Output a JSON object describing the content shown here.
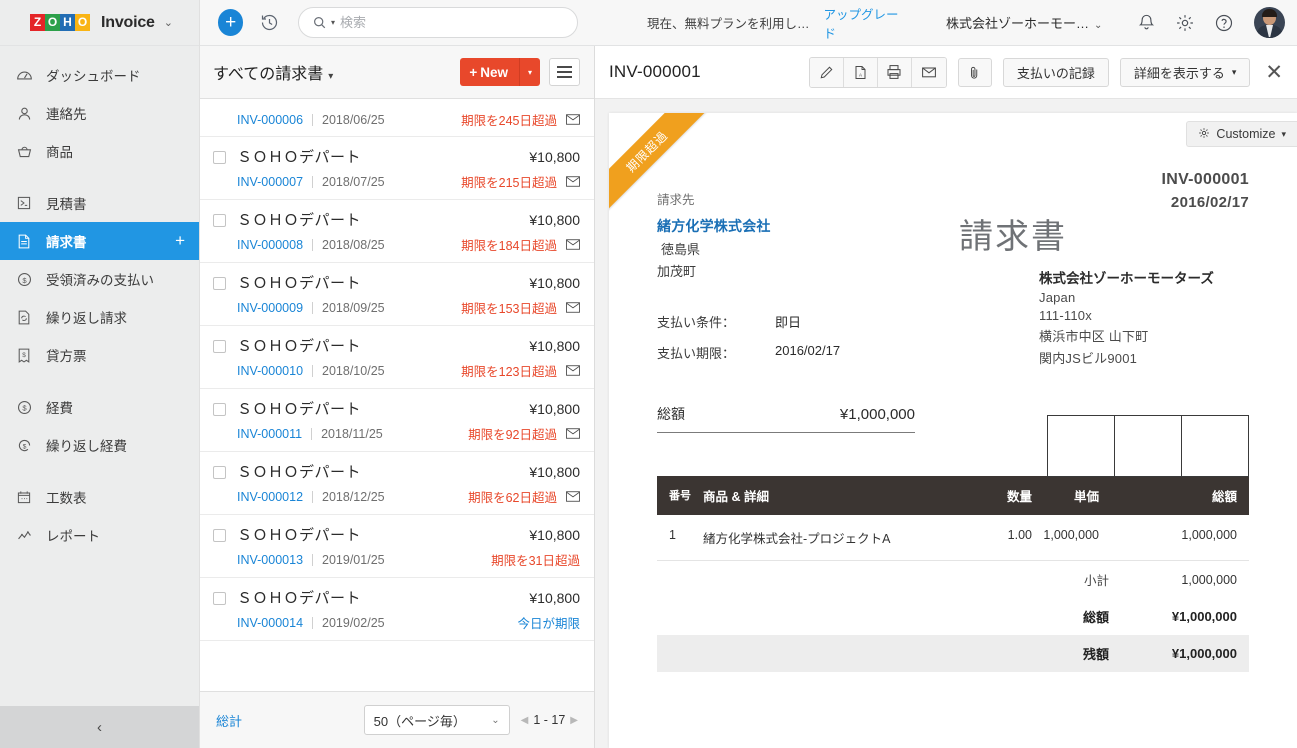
{
  "brand": {
    "name": "Invoice",
    "logo_letters": [
      "Z",
      "O",
      "H",
      "O"
    ],
    "caret": "⌄"
  },
  "sidebar": {
    "items": [
      {
        "label": "ダッシュボード",
        "icon": "dashboard-icon",
        "active": false
      },
      {
        "label": "連絡先",
        "icon": "contacts-icon",
        "active": false
      },
      {
        "label": "商品",
        "icon": "items-icon",
        "active": false
      },
      {
        "label": "見積書",
        "icon": "estimates-icon",
        "active": false
      },
      {
        "label": "請求書",
        "icon": "invoices-icon",
        "active": true,
        "plus": "+"
      },
      {
        "label": "受領済みの支払い",
        "icon": "payments-received-icon",
        "active": false
      },
      {
        "label": "繰り返し請求",
        "icon": "recurring-invoice-icon",
        "active": false
      },
      {
        "label": "貸方票",
        "icon": "credit-notes-icon",
        "active": false
      },
      {
        "label": "経費",
        "icon": "expenses-icon",
        "active": false
      },
      {
        "label": "繰り返し経費",
        "icon": "recurring-expenses-icon",
        "active": false
      },
      {
        "label": "工数表",
        "icon": "timesheet-icon",
        "active": false
      },
      {
        "label": "レポート",
        "icon": "reports-icon",
        "active": false
      }
    ],
    "collapse_icon": "chevron-left-icon"
  },
  "topbar": {
    "add_label": "+",
    "history_icon": "clock-history-icon",
    "search_placeholder": "検索",
    "search_value": "",
    "search_icon": "search-icon",
    "search_dropdown_caret": "▾",
    "plan_text": "現在、無料プランを利用し…",
    "upgrade_label": "アップグレード",
    "org_name": "株式会社ゾーホーモー…",
    "org_caret": "⌄",
    "bell_icon": "notifications-bell-icon",
    "gear_icon": "settings-gear-icon",
    "help_icon": "help-question-icon",
    "avatar": "user-avatar"
  },
  "list": {
    "title": "すべての請求書",
    "title_caret": "▾",
    "new_button": "New",
    "new_plus": "+",
    "new_caret": "▾",
    "menu_icon": "list-view-menu-icon",
    "rows": [
      {
        "customer": "",
        "amount": "",
        "number": "INV-000006",
        "date": "2018/06/25",
        "status": "期限を245日超過",
        "partial": true,
        "mail": true,
        "due_today": false
      },
      {
        "customer": "ＳＯＨＯデパート",
        "amount": "¥10,800",
        "number": "INV-000007",
        "date": "2018/07/25",
        "status": "期限を215日超過",
        "partial": false,
        "mail": true,
        "due_today": false
      },
      {
        "customer": "ＳＯＨＯデパート",
        "amount": "¥10,800",
        "number": "INV-000008",
        "date": "2018/08/25",
        "status": "期限を184日超過",
        "partial": false,
        "mail": true,
        "due_today": false
      },
      {
        "customer": "ＳＯＨＯデパート",
        "amount": "¥10,800",
        "number": "INV-000009",
        "date": "2018/09/25",
        "status": "期限を153日超過",
        "partial": false,
        "mail": true,
        "due_today": false
      },
      {
        "customer": "ＳＯＨＯデパート",
        "amount": "¥10,800",
        "number": "INV-000010",
        "date": "2018/10/25",
        "status": "期限を123日超過",
        "partial": false,
        "mail": true,
        "due_today": false
      },
      {
        "customer": "ＳＯＨＯデパート",
        "amount": "¥10,800",
        "number": "INV-000011",
        "date": "2018/11/25",
        "status": "期限を92日超過",
        "partial": false,
        "mail": true,
        "due_today": false
      },
      {
        "customer": "ＳＯＨＯデパート",
        "amount": "¥10,800",
        "number": "INV-000012",
        "date": "2018/12/25",
        "status": "期限を62日超過",
        "partial": false,
        "mail": true,
        "due_today": false
      },
      {
        "customer": "ＳＯＨＯデパート",
        "amount": "¥10,800",
        "number": "INV-000013",
        "date": "2019/01/25",
        "status": "期限を31日超過",
        "partial": false,
        "mail": false,
        "due_today": false
      },
      {
        "customer": "ＳＯＨＯデパート",
        "amount": "¥10,800",
        "number": "INV-000014",
        "date": "2019/02/25",
        "status": "今日が期限",
        "partial": false,
        "mail": false,
        "due_today": true
      }
    ],
    "footer": {
      "total_label": "総計",
      "per_page": "50（ページ毎）",
      "per_page_caret": "⌄",
      "range": "1 - 17",
      "prev_icon": "page-prev-icon",
      "next_icon": "page-next-icon"
    }
  },
  "detail": {
    "title": "INV-000001",
    "tools": {
      "edit_icon": "edit-pencil-icon",
      "pdf_icon": "pdf-file-icon",
      "print_icon": "printer-icon",
      "email_icon": "email-envelope-icon",
      "attach_icon": "paperclip-icon",
      "record_payment": "支払いの記録",
      "show_details": "詳細を表示する",
      "show_details_caret": "▾",
      "close_icon": "close-x-icon"
    },
    "ribbon": "期限超過",
    "customize": {
      "label": "Customize",
      "icon": "gear-icon",
      "caret": "▾"
    },
    "document": {
      "invoice_number": "INV-000001",
      "invoice_date": "2016/02/17",
      "doc_type": "請求書",
      "bill_to_label": "請求先",
      "bill_to_name": "緒方化学株式会社",
      "bill_to_lines": [
        "徳島県",
        "加茂町"
      ],
      "from_name": "株式会社ゾーホーモーターズ",
      "from_lines": [
        "Japan",
        "111-110x",
        "横浜市中区 山下町",
        "関内JSビル9001"
      ],
      "terms_label": "支払い条件：",
      "terms_value": "即日",
      "duedate_label": "支払い期限：",
      "duedate_value": "2016/02/17",
      "grand_label": "総額",
      "grand_value": "¥1,000,000",
      "table": {
        "headers": {
          "no": "番号",
          "desc": "商品 & 詳細",
          "qty": "数量",
          "rate": "単価",
          "amount": "総額"
        },
        "rows": [
          {
            "no": "1",
            "desc": "緒方化学株式会社-プロジェクトA",
            "qty": "1.00",
            "rate": "1,000,000",
            "amount": "1,000,000"
          }
        ]
      },
      "totals": [
        {
          "label": "小計",
          "value": "1,000,000",
          "bold": false,
          "highlight": false
        },
        {
          "label": "総額",
          "value": "¥1,000,000",
          "bold": true,
          "highlight": false
        },
        {
          "label": "残額",
          "value": "¥1,000,000",
          "bold": true,
          "highlight": true
        }
      ]
    }
  }
}
